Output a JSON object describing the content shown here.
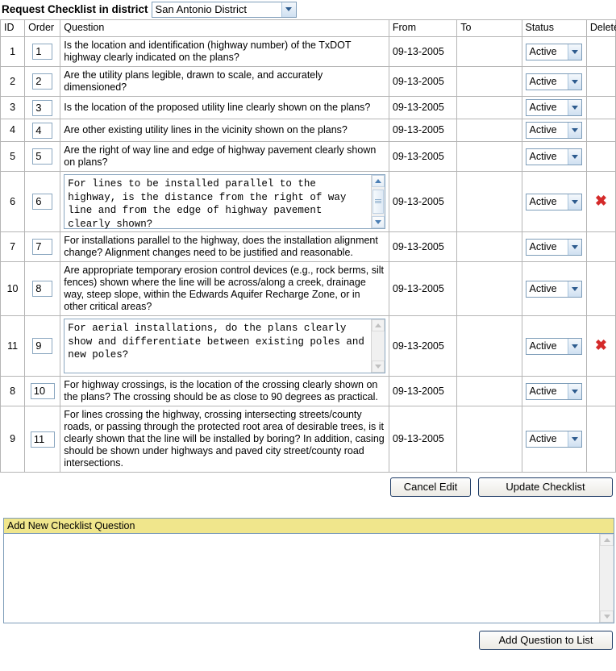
{
  "header": {
    "title": "Request Checklist in district",
    "district_select": {
      "value": "San Antonio District",
      "icon": "chevron-down-icon"
    }
  },
  "table": {
    "columns": [
      "ID",
      "Order",
      "Question",
      "From",
      "To",
      "Status",
      "Delete"
    ],
    "rows": [
      {
        "id": "1",
        "order": "1",
        "question": "Is the location and identification (highway number) of the TxDOT highway clearly indicated on the plans?",
        "question_type": "text",
        "from": "09-13-2005",
        "to": "",
        "status": "Active",
        "delete": false
      },
      {
        "id": "2",
        "order": "2",
        "question": "Are the utility plans legible, drawn to scale, and accurately dimensioned?",
        "question_type": "text",
        "from": "09-13-2005",
        "to": "",
        "status": "Active",
        "delete": false
      },
      {
        "id": "3",
        "order": "3",
        "question": "Is the location of the proposed utility line clearly shown on the plans?",
        "question_type": "text",
        "from": "09-13-2005",
        "to": "",
        "status": "Active",
        "delete": false
      },
      {
        "id": "4",
        "order": "4",
        "question": "Are other existing utility lines in the vicinity shown on the plans?",
        "question_type": "text",
        "from": "09-13-2005",
        "to": "",
        "status": "Active",
        "delete": false
      },
      {
        "id": "5",
        "order": "5",
        "question": "Are the right of way line and edge of highway pavement clearly shown on plans?",
        "question_type": "text",
        "from": "09-13-2005",
        "to": "",
        "status": "Active",
        "delete": false
      },
      {
        "id": "6",
        "order": "6",
        "question": "For lines to be installed parallel to the highway, is the distance from the right of way line and from the edge of highway pavement clearly shown?",
        "question_type": "textarea",
        "scrollbar": "active",
        "from": "09-13-2005",
        "to": "",
        "status": "Active",
        "delete": true
      },
      {
        "id": "7",
        "order": "7",
        "question": "For installations parallel to the highway, does the installation alignment change? Alignment changes need to be justified and reasonable.",
        "question_type": "text",
        "from": "09-13-2005",
        "to": "",
        "status": "Active",
        "delete": false
      },
      {
        "id": "10",
        "order": "8",
        "question": "Are appropriate temporary erosion control devices (e.g., rock berms, silt fences) shown where the line will be across/along a creek, drainage way, steep slope, within the Edwards Aquifer Recharge Zone, or in other critical areas?",
        "question_type": "text",
        "from": "09-13-2005",
        "to": "",
        "status": "Active",
        "delete": false
      },
      {
        "id": "11",
        "order": "9",
        "question": "For aerial installations, do the plans clearly show and differentiate between existing poles and new poles?",
        "question_type": "textarea",
        "scrollbar": "disabled",
        "from": "09-13-2005",
        "to": "",
        "status": "Active",
        "delete": true
      },
      {
        "id": "8",
        "order": "10",
        "question": "For highway crossings, is the location of the crossing clearly shown on the plans? The crossing should be as close to 90 degrees as practical.",
        "question_type": "text",
        "from": "09-13-2005",
        "to": "",
        "status": "Active",
        "delete": false
      },
      {
        "id": "9",
        "order": "11",
        "question": "For lines crossing the highway, crossing intersecting streets/county roads, or passing through the protected root area of desirable trees, is it clearly shown that the line will be installed by boring? In addition, casing should be shown under highways and paved city street/county road intersections.",
        "question_type": "text",
        "from": "09-13-2005",
        "to": "",
        "status": "Active",
        "delete": false
      }
    ]
  },
  "toolbar": {
    "cancel_label": "Cancel Edit",
    "update_label": "Update Checklist"
  },
  "add_section": {
    "header": "Add New Checklist Question",
    "textarea_value": "",
    "add_button_label": "Add Question to List"
  },
  "colors": {
    "accent": "#7e9db9",
    "header_yellow": "#f0e68c",
    "delete_red": "#d42a2a",
    "button_border": "#1f3c66"
  },
  "icons": {
    "delete": "red-x-icon",
    "dropdown": "chevron-down-icon",
    "scroll_up": "scroll-up-arrow-icon",
    "scroll_down": "scroll-down-arrow-icon"
  }
}
